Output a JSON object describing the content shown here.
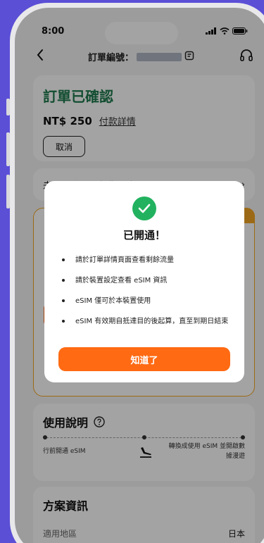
{
  "status_bar": {
    "time": "8:00"
  },
  "header": {
    "order_label": "訂單編號："
  },
  "order": {
    "status_title": "訂單已確認",
    "price": "NT$ 250",
    "payment_link": "付款詳情",
    "cancel_label": "取消"
  },
  "refund_row": {
    "label": "未使用流量可免費取消",
    "chevron": "›"
  },
  "guide": {
    "title": "使用說明",
    "step_left": "行前開通 eSIM",
    "step_right_line1": "轉換成使用 eSIM 並開啟數",
    "step_right_line2": "據漫遊"
  },
  "plan": {
    "title": "方案資訊",
    "region_label": "適用地區",
    "region_value": "日本"
  },
  "modal": {
    "title": "已開通！",
    "bullets": [
      "請於訂單詳情頁面查看剩餘流量",
      "請於裝置設定查看 eSIM 資訊",
      "eSIM 僅可於本裝置使用",
      "eSIM 有效期自抵達目的後起算，直至到期日結束"
    ],
    "ok_label": "知道了"
  },
  "colors": {
    "background": "#5b4fd6",
    "success_green": "#1f7a4e",
    "check_green": "#22b25f",
    "accent_orange": "#ff6a13",
    "ticket_border": "#f5a623"
  },
  "icons": [
    "back-arrow-icon",
    "signal-icon",
    "wifi-icon",
    "battery-icon",
    "copy-icon",
    "headset-icon",
    "help-icon",
    "plane-landing-icon",
    "checkmark-icon"
  ]
}
